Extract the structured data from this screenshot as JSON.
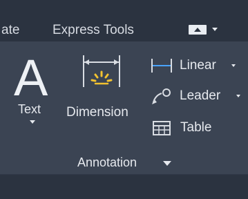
{
  "tabs": [
    {
      "label": "ate"
    },
    {
      "label": "Express Tools"
    }
  ],
  "ribbon": {
    "text_button": {
      "big_glyph": "A",
      "label": "Text"
    },
    "dimension_button": {
      "label": "Dimension"
    },
    "linear": {
      "label": "Linear"
    },
    "leader": {
      "label": "Leader"
    },
    "table": {
      "label": "Table"
    },
    "panel_title": "Annotation"
  },
  "colors": {
    "tab_bar_bg": "#2b3340",
    "ribbon_bg": "#3b4453",
    "accent_blue": "#4aa3ff",
    "accent_yellow": "#f2c230"
  }
}
